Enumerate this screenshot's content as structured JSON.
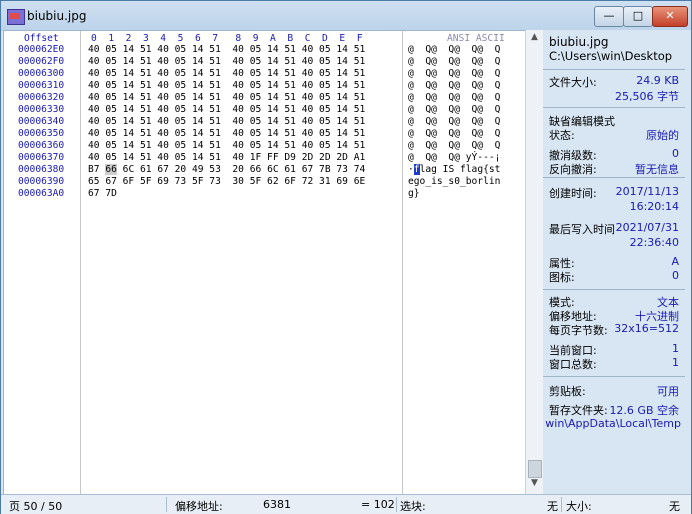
{
  "window": {
    "title": "biubiu.jpg",
    "min_label": "—",
    "max_label": "□",
    "close_label": "✕"
  },
  "hex": {
    "offset_header": "Offset",
    "column_header": "0  1  2  3  4  5  6  7   8  9  A  B  C  D  E  F",
    "ascii_header": "ANSI ASCII",
    "rows": [
      {
        "offset": "000062E0",
        "bytes": "40 05 14 51 40 05 14 51  40 05 14 51 40 05 14 51",
        "ascii": "@  Q@  Q@  Q@  Q"
      },
      {
        "offset": "000062F0",
        "bytes": "40 05 14 51 40 05 14 51  40 05 14 51 40 05 14 51",
        "ascii": "@  Q@  Q@  Q@  Q"
      },
      {
        "offset": "00006300",
        "bytes": "40 05 14 51 40 05 14 51  40 05 14 51 40 05 14 51",
        "ascii": "@  Q@  Q@  Q@  Q"
      },
      {
        "offset": "00006310",
        "bytes": "40 05 14 51 40 05 14 51  40 05 14 51 40 05 14 51",
        "ascii": "@  Q@  Q@  Q@  Q"
      },
      {
        "offset": "00006320",
        "bytes": "40 05 14 51 40 05 14 51  40 05 14 51 40 05 14 51",
        "ascii": "@  Q@  Q@  Q@  Q"
      },
      {
        "offset": "00006330",
        "bytes": "40 05 14 51 40 05 14 51  40 05 14 51 40 05 14 51",
        "ascii": "@  Q@  Q@  Q@  Q"
      },
      {
        "offset": "00006340",
        "bytes": "40 05 14 51 40 05 14 51  40 05 14 51 40 05 14 51",
        "ascii": "@  Q@  Q@  Q@  Q"
      },
      {
        "offset": "00006350",
        "bytes": "40 05 14 51 40 05 14 51  40 05 14 51 40 05 14 51",
        "ascii": "@  Q@  Q@  Q@  Q"
      },
      {
        "offset": "00006360",
        "bytes": "40 05 14 51 40 05 14 51  40 05 14 51 40 05 14 51",
        "ascii": "@  Q@  Q@  Q@  Q"
      },
      {
        "offset": "00006370",
        "bytes": "40 05 14 51 40 05 14 51  40 1F FF D9 2D 2D 2D A1",
        "ascii": "@  Q@  Q@ yÝ---¡"
      },
      {
        "offset": "00006380",
        "bytes_pre": "B7 ",
        "bytes_cursor": "66",
        "bytes_post": " 6C 61 67 20 49 53  20 66 6C 61 67 7B 73 74",
        "ascii_pre": "·",
        "ascii_hl": "f",
        "ascii_post": "lag IS flag{st"
      },
      {
        "offset": "00006390",
        "bytes": "65 67 6F 5F 69 73 5F 73  30 5F 62 6F 72 31 69 6E",
        "ascii": "ego_is_s0_borlin"
      },
      {
        "offset": "000063A0",
        "bytes": "67 7D",
        "ascii": "g}"
      }
    ]
  },
  "side": {
    "file_name": "biubiu.jpg",
    "file_path": "C:\\Users\\win\\Desktop",
    "size_label": "文件大小:",
    "size_kb": "24.9 KB",
    "size_bytes": "25,506 字节",
    "edit_mode": "缺省编辑模式",
    "state_label": "状态:",
    "state_value": "原始的",
    "undo_label": "撤消级数:",
    "undo_value": "0",
    "redo_label": "反向撤消:",
    "redo_value": "暂无信息",
    "created_label": "创建时间:",
    "created_date": "2017/11/13",
    "created_time": "16:20:14",
    "modified_label": "最后写入时间",
    "modified_date": "2021/07/31",
    "modified_time": "22:36:40",
    "attr_label": "属性:",
    "attr_value": "A",
    "icon_label": "图标:",
    "icon_value": "0",
    "mode_label": "模式:",
    "mode_value": "文本",
    "offset_label": "偏移地址:",
    "offset_value": "十六进制",
    "bpp_label": "每页字节数:",
    "bpp_value": "32x16=512",
    "curwin_label": "当前窗口:",
    "curwin_value": "1",
    "totwin_label": "窗口总数:",
    "totwin_value": "1",
    "clip_label": "剪贴板:",
    "clip_value": "可用",
    "temp_label": "暂存文件夹:",
    "temp_value": "12.6 GB 空余",
    "temp_path": "win\\AppData\\Local\\Temp"
  },
  "status": {
    "page": "页 50 / 50",
    "offset_label": "偏移地址:",
    "offset_value": "6381",
    "eq_value": "= 102",
    "select_label": "选块:",
    "select_value": "无",
    "size_label": "大小:",
    "size_value": "无"
  }
}
